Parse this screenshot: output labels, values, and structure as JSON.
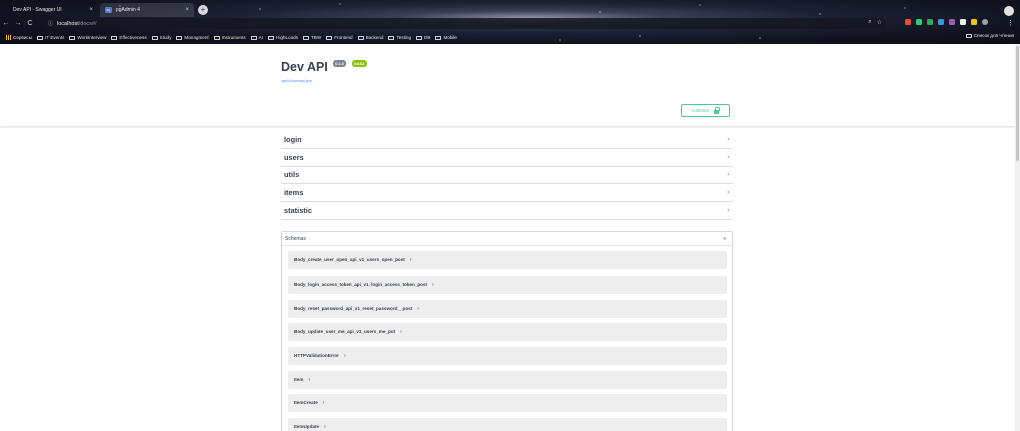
{
  "browser": {
    "tabs": [
      {
        "title": "Dev API - Swagger UI",
        "close": "×"
      },
      {
        "title": "pgAdmin 4",
        "favicon": "Pg",
        "close": "×"
      }
    ],
    "new_tab": "+",
    "nav": {
      "back": "←",
      "forward": "→",
      "reload": "C"
    },
    "address": {
      "info": "ⓘ",
      "host": "localhost",
      "path": "/docs#/"
    },
    "omnibox_icons": [
      "search-icon",
      "star-icon"
    ],
    "extensions_colors": [
      "#e74c3c",
      "#2ecc71",
      "#27ae60",
      "#3498db",
      "#9b59b6",
      "#ecf0f1",
      "#f1c40f",
      "#95a5a6"
    ],
    "menu": "⋮",
    "bookmarks": [
      {
        "label": "Сервисы",
        "type": "apps"
      },
      {
        "label": "IT Events"
      },
      {
        "label": "WorkInterview"
      },
      {
        "label": "Effectiveness"
      },
      {
        "label": "Study"
      },
      {
        "label": "Managment"
      },
      {
        "label": "Instruments"
      },
      {
        "label": "AI"
      },
      {
        "label": "HighLoads"
      },
      {
        "label": "TBW"
      },
      {
        "label": "Frontend"
      },
      {
        "label": "Backend"
      },
      {
        "label": "Testing"
      },
      {
        "label": "DB"
      },
      {
        "label": "Mobile"
      }
    ],
    "reading_list": "Список для чтения"
  },
  "swagger": {
    "title": "Dev API",
    "version_badge": "0.1.0",
    "oas_badge": "OAS3",
    "openapi_link": "/api/v1/openapi.json",
    "authorize_label": "Authorize",
    "tags": [
      "login",
      "users",
      "utils",
      "items",
      "statistic"
    ],
    "tag_chevron": "›",
    "schemas_title": "Schemas",
    "schemas_chevron": "∨",
    "models": [
      "Body_create_user_open_api_v1_users_open_post",
      "Body_login_access_token_api_v1_login_access_token_post",
      "Body_reset_password_api_v1_reset_password__post",
      "Body_update_user_me_api_v1_users_me_put",
      "HTTPValidationError",
      "Item",
      "ItemCreate",
      "ItemUpdate"
    ],
    "model_arrow": "›"
  },
  "colors": {
    "oas_green": "#89bf04",
    "authorize_green": "#49cc90",
    "text": "#3b4151"
  }
}
